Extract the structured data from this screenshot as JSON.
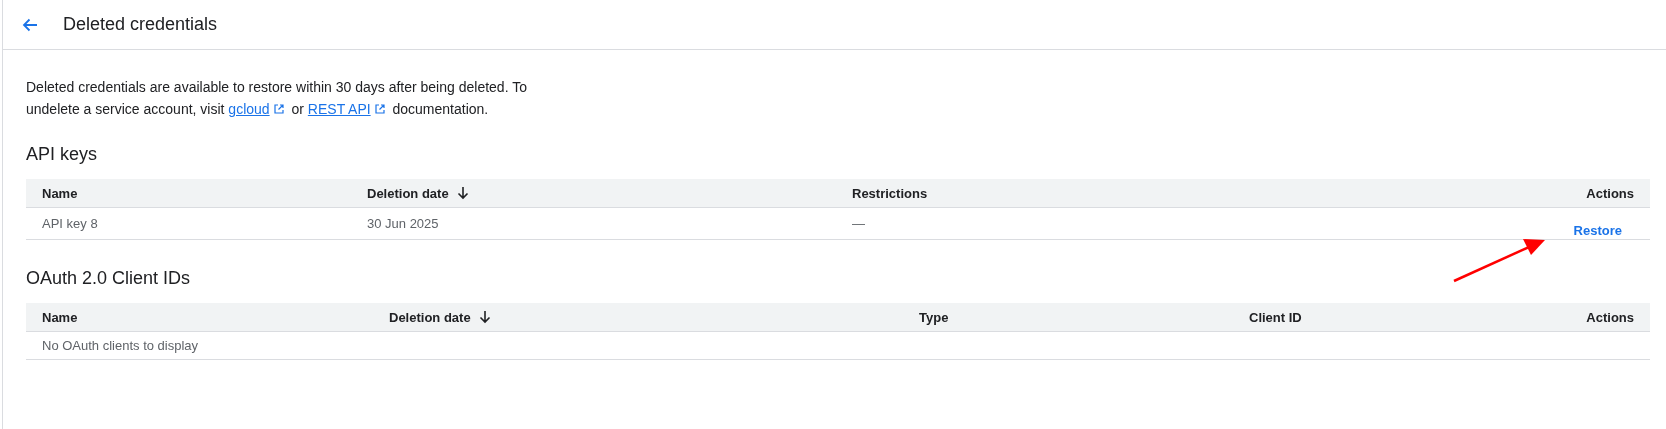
{
  "header": {
    "title": "Deleted credentials"
  },
  "notice": {
    "text_before": "Deleted credentials are available to restore within 30 days after being deleted. To undelete a service account, visit",
    "links": [
      {
        "label": "gcloud",
        "separator_after": "or"
      },
      {
        "label": "REST API",
        "separator_after": "documentation."
      }
    ]
  },
  "sections": [
    {
      "title": "API keys",
      "columns": [
        {
          "label": "Name",
          "sorted": false
        },
        {
          "label": "Deletion date",
          "sorted": true
        },
        {
          "label": "Restrictions",
          "sorted": false
        },
        {
          "label": "Actions",
          "sorted": false
        }
      ],
      "rows": [
        {
          "cells": [
            "API key 8",
            "30 Jun 2025",
            "—"
          ],
          "action": "Restore"
        }
      ]
    },
    {
      "title": "OAuth 2.0 Client IDs",
      "columns": [
        {
          "label": "Name",
          "sorted": false
        },
        {
          "label": "Deletion date",
          "sorted": true
        },
        {
          "label": "Type",
          "sorted": false
        },
        {
          "label": "Client ID",
          "sorted": false
        },
        {
          "label": "Actions",
          "sorted": false
        }
      ],
      "empty": "No OAuth clients to display"
    }
  ]
}
